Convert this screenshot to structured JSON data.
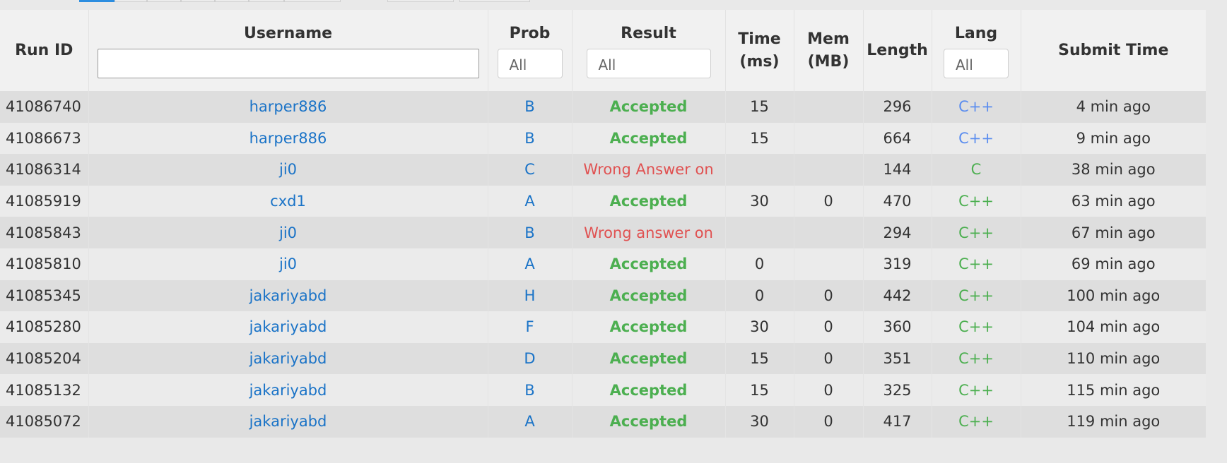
{
  "header": {
    "run_id": "Run ID",
    "username": "Username",
    "prob": "Prob",
    "result": "Result",
    "time_line1": "Time",
    "time_line2": "(ms)",
    "mem_line1": "Mem",
    "mem_line2": "(MB)",
    "length": "Length",
    "lang": "Lang",
    "submit_time": "Submit Time"
  },
  "filters": {
    "username_value": "",
    "prob": "All",
    "result": "All",
    "lang": "All"
  },
  "rows": [
    {
      "run_id": "41086740",
      "user": "harper886",
      "prob": "B",
      "result": "Accepted",
      "time": "15",
      "mem": "",
      "length": "296",
      "lang": "C++",
      "submit": "4 min ago"
    },
    {
      "run_id": "41086673",
      "user": "harper886",
      "prob": "B",
      "result": "Accepted",
      "time": "15",
      "mem": "",
      "length": "664",
      "lang": "C++",
      "submit": "9 min ago"
    },
    {
      "run_id": "41086314",
      "user": "ji0",
      "prob": "C",
      "result": "Wrong Answer on",
      "time": "",
      "mem": "",
      "length": "144",
      "lang": "C",
      "submit": "38 min ago"
    },
    {
      "run_id": "41085919",
      "user": "cxd1",
      "prob": "A",
      "result": "Accepted",
      "time": "30",
      "mem": "0",
      "length": "470",
      "lang": "C++",
      "submit": "63 min ago"
    },
    {
      "run_id": "41085843",
      "user": "ji0",
      "prob": "B",
      "result": "Wrong answer on",
      "time": "",
      "mem": "",
      "length": "294",
      "lang": "C++",
      "submit": "67 min ago"
    },
    {
      "run_id": "41085810",
      "user": "ji0",
      "prob": "A",
      "result": "Accepted",
      "time": "0",
      "mem": "",
      "length": "319",
      "lang": "C++",
      "submit": "69 min ago"
    },
    {
      "run_id": "41085345",
      "user": "jakariyabd",
      "prob": "H",
      "result": "Accepted",
      "time": "0",
      "mem": "0",
      "length": "442",
      "lang": "C++",
      "submit": "100 min ago"
    },
    {
      "run_id": "41085280",
      "user": "jakariyabd",
      "prob": "F",
      "result": "Accepted",
      "time": "30",
      "mem": "0",
      "length": "360",
      "lang": "C++",
      "submit": "104 min ago"
    },
    {
      "run_id": "41085204",
      "user": "jakariyabd",
      "prob": "D",
      "result": "Accepted",
      "time": "15",
      "mem": "0",
      "length": "351",
      "lang": "C++",
      "submit": "110 min ago"
    },
    {
      "run_id": "41085132",
      "user": "jakariyabd",
      "prob": "B",
      "result": "Accepted",
      "time": "15",
      "mem": "0",
      "length": "325",
      "lang": "C++",
      "submit": "115 min ago"
    },
    {
      "run_id": "41085072",
      "user": "jakariyabd",
      "prob": "A",
      "result": "Accepted",
      "time": "30",
      "mem": "0",
      "length": "417",
      "lang": "C++",
      "submit": "119 min ago"
    }
  ],
  "colors": {
    "accepted": "#4caf50",
    "wrong": "#e05151",
    "link": "#1a73c7",
    "lang_cpp_first": "#5b8def",
    "lang_green": "#4caf50",
    "active_tab": "#2d8ee0"
  }
}
